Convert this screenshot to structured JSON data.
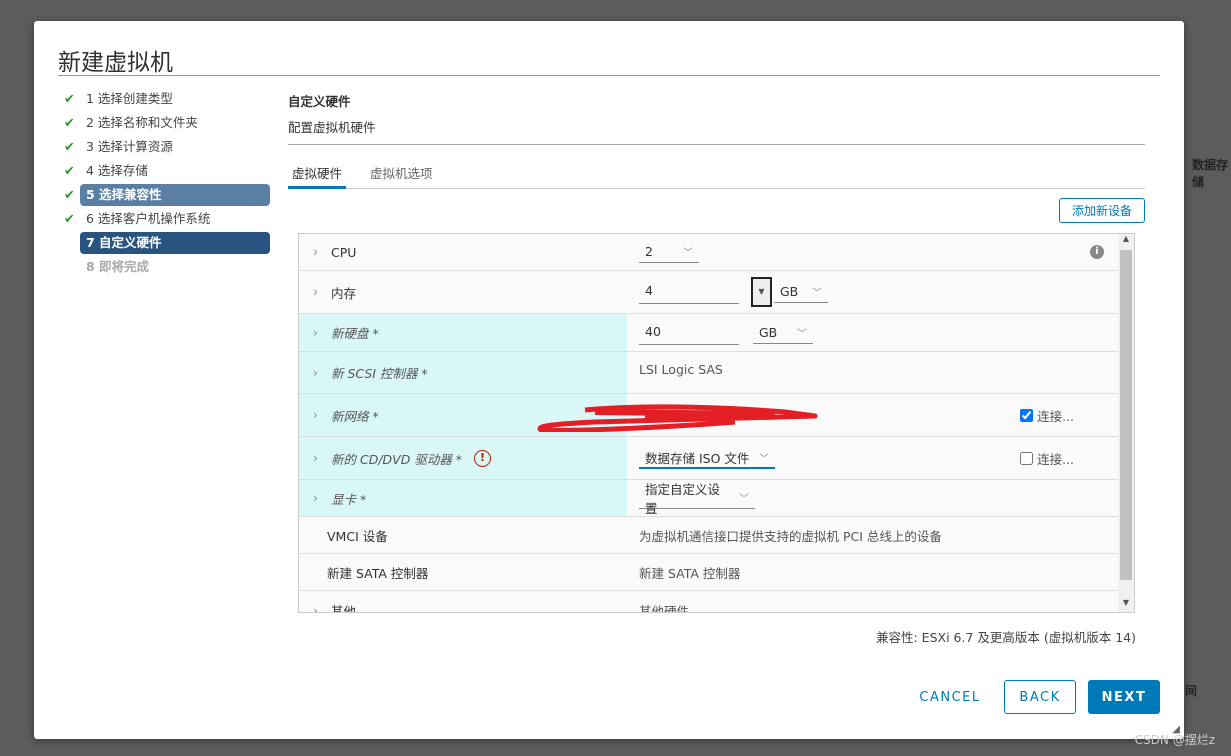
{
  "background": {
    "col_header": "数据存储",
    "col_header2": "间"
  },
  "dialog": {
    "title": "新建虚拟机"
  },
  "steps": [
    {
      "label": "1 选择创建类型",
      "done": true
    },
    {
      "label": "2 选择名称和文件夹",
      "done": true
    },
    {
      "label": "3 选择计算资源",
      "done": true
    },
    {
      "label": "4 选择存储",
      "done": true
    },
    {
      "label": "5 选择兼容性",
      "done": true
    },
    {
      "label": "6 选择客户机操作系统",
      "done": true
    },
    {
      "label": "7 自定义硬件",
      "done": false
    },
    {
      "label": "8 即将完成",
      "done": false
    }
  ],
  "section": {
    "title": "自定义硬件",
    "subtitle": "配置虚拟机硬件"
  },
  "tabs": [
    {
      "label": "虚拟硬件",
      "active": true
    },
    {
      "label": "虚拟机选项",
      "active": false
    }
  ],
  "add_device_label": "添加新设备",
  "hardware": {
    "cpu": {
      "label": "CPU",
      "value": "2"
    },
    "memory": {
      "label": "内存",
      "value": "4",
      "unit": "GB"
    },
    "disk": {
      "label": "新硬盘 *",
      "value": "40",
      "unit": "GB"
    },
    "scsi": {
      "label": "新 SCSI 控制器 *",
      "value": "LSI Logic SAS"
    },
    "network": {
      "label": "新网络 *",
      "connect": "连接...",
      "connected": true
    },
    "cdrom": {
      "label": "新的 CD/DVD 驱动器 *",
      "value": "数据存储 ISO 文件",
      "connect": "连接...",
      "connected": false
    },
    "video": {
      "label": "显卡 *",
      "value": "指定自定义设置"
    },
    "vmci": {
      "label": "VMCI 设备",
      "value": "为虚拟机通信接口提供支持的虚拟机 PCI 总线上的设备"
    },
    "sata": {
      "label": "新建 SATA 控制器",
      "value": "新建 SATA 控制器"
    },
    "other": {
      "label": "其他",
      "value": "其他硬件"
    }
  },
  "compat": "兼容性: ESXi 6.7 及更高版本 (虚拟机版本 14)",
  "buttons": {
    "cancel": "CANCEL",
    "back": "BACK",
    "next": "NEXT"
  },
  "watermark": "CSDN @摆烂z",
  "colors": {
    "accent": "#0079b8",
    "highlight_row": "#d9f7f7",
    "step_active": "#2a5480",
    "step_prev": "#5b7ea3",
    "check": "#2e9b2e",
    "redaction": "#e31e24"
  }
}
